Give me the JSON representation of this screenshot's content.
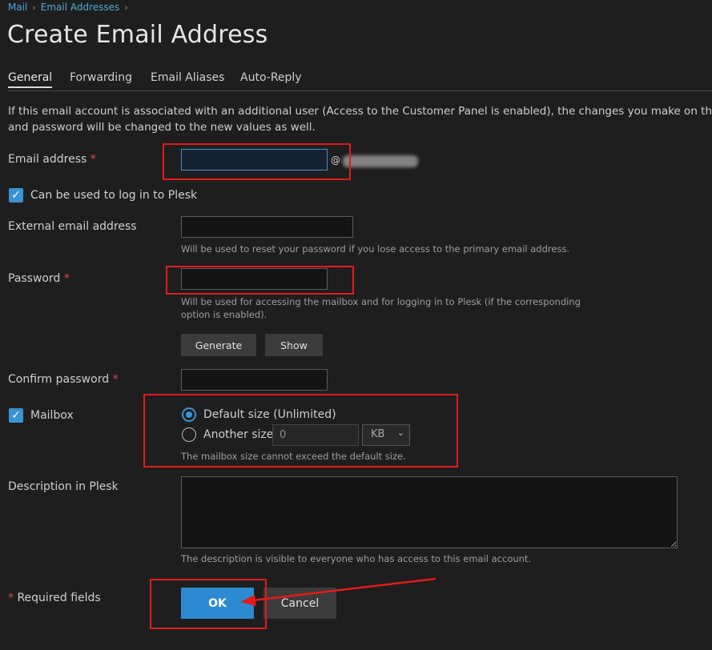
{
  "breadcrumb": {
    "items": [
      "Mail",
      "Email Addresses"
    ]
  },
  "page_title": "Create Email Address",
  "tabs": [
    "General",
    "Forwarding",
    "Email Aliases",
    "Auto-Reply"
  ],
  "intro": {
    "line1": "If this email account is associated with an additional user (Access to the Customer Panel is enabled), the changes you make on this page",
    "line2": "and password will be changed to the new values as well."
  },
  "form": {
    "email_label": "Email address",
    "required_mark": "*",
    "email_value": "",
    "at_sign": "@",
    "login_checkbox_label": "Can be used to log in to Plesk",
    "external_email_label": "External email address",
    "external_email_hint": "Will be used to reset your password if you lose access to the primary email address.",
    "password_label": "Password",
    "password_hint_line1": "Will be used for accessing the mailbox and for logging in to Plesk (if the corresponding",
    "password_hint_line2": "option is enabled).",
    "generate_button": "Generate",
    "show_button": "Show",
    "confirm_password_label": "Confirm password",
    "mailbox_label": "Mailbox",
    "default_size_label": "Default size (Unlimited)",
    "another_size_label": "Another size",
    "another_size_value": "0",
    "size_unit": "KB",
    "mailbox_hint": "The mailbox size cannot exceed the default size.",
    "description_label": "Description in Plesk",
    "description_hint": "The description is visible to everyone who has access to this email account.",
    "required_fields_label": "Required fields",
    "ok_button": "OK",
    "cancel_button": "Cancel"
  },
  "colors": {
    "background": "#1e1e1e",
    "accent": "#3a94d3",
    "annotation": "#e41a1a",
    "link": "#4ea8de"
  },
  "icons": [
    "chevron-right-icon",
    "checkmark-icon",
    "chevron-down-icon"
  ]
}
